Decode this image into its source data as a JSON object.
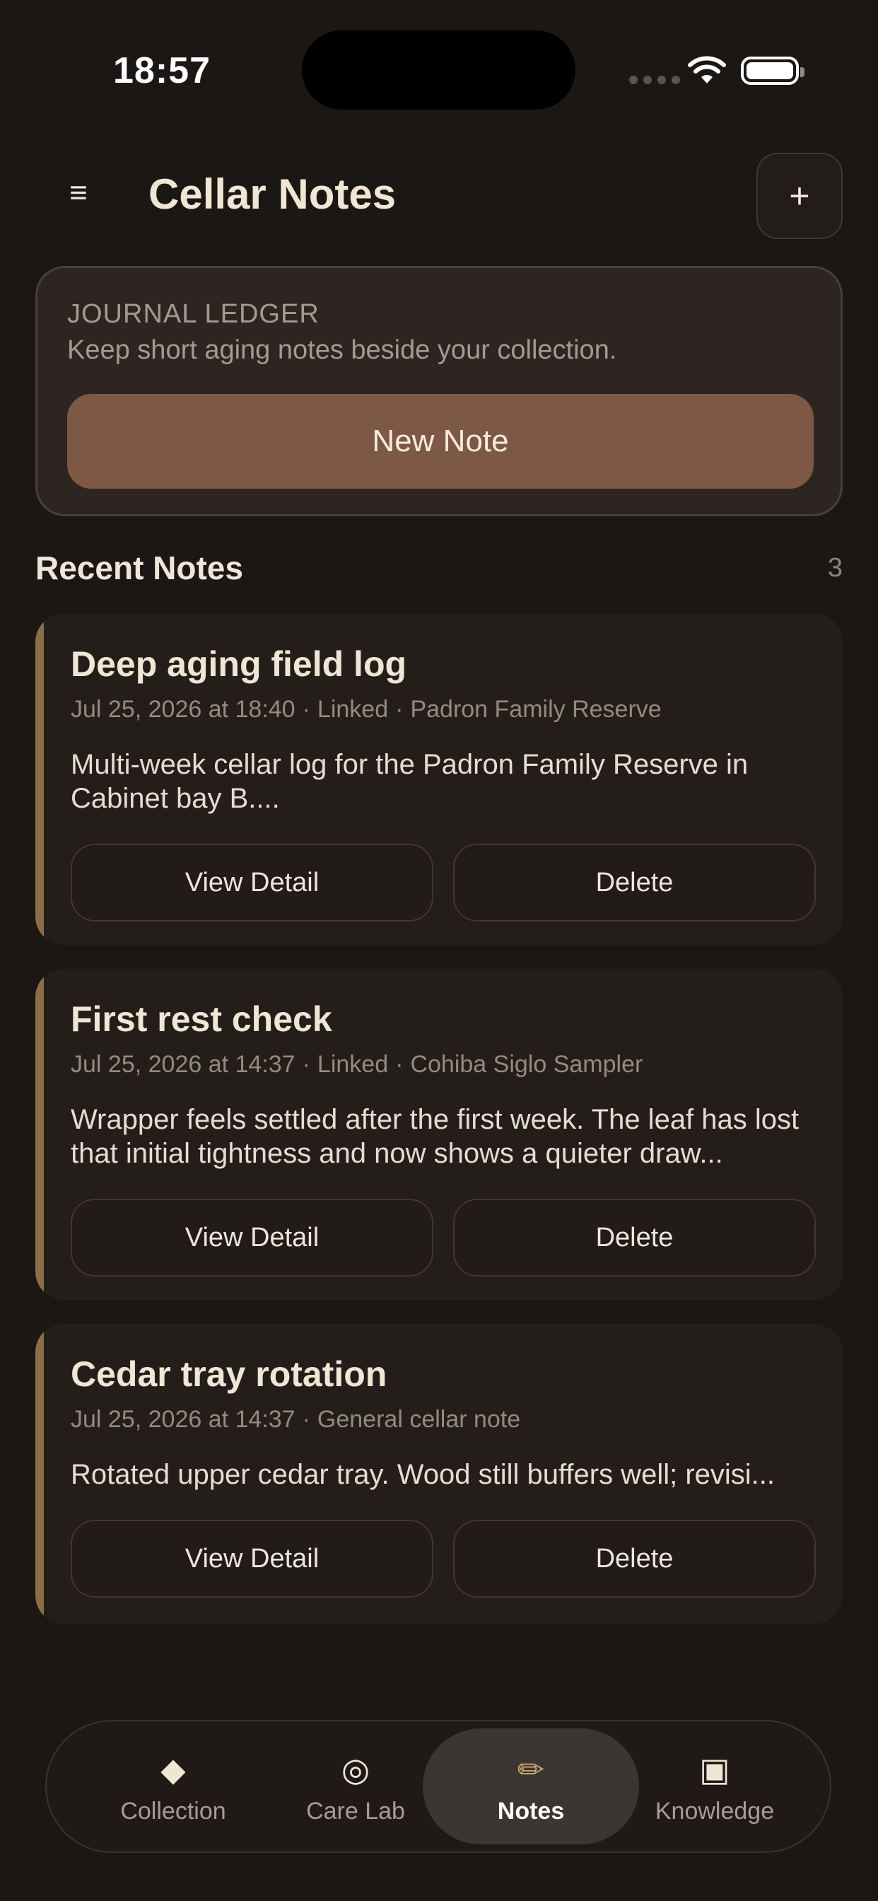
{
  "status_bar": {
    "time": "18:57"
  },
  "header": {
    "title": "Cellar Notes",
    "menu_icon": "≡",
    "add_icon": "+"
  },
  "ledger": {
    "eyebrow": "JOURNAL LEDGER",
    "description": "Keep short aging notes beside your collection.",
    "button_label": "New Note"
  },
  "section": {
    "title": "Recent Notes",
    "count": "3"
  },
  "notes": [
    {
      "title": "Deep aging field log",
      "date": "Jul 25, 2026 at 18:40",
      "status": "Linked",
      "linked_item": "Padron Family Reserve",
      "body": "Multi-week cellar log for the Padron Family Reserve in Cabinet bay B....",
      "view_label": "View Detail",
      "delete_label": "Delete"
    },
    {
      "title": "First rest check",
      "date": "Jul 25, 2026 at 14:37",
      "status": "Linked",
      "linked_item": "Cohiba Siglo Sampler",
      "body": "Wrapper feels settled after the first week. The leaf has lost that initial tightness and now shows a quieter draw...",
      "view_label": "View Detail",
      "delete_label": "Delete"
    },
    {
      "title": "Cedar tray rotation",
      "date": "Jul 25, 2026 at 14:37",
      "status": "General cellar note",
      "body": "Rotated upper cedar tray. Wood still buffers well; revisi...",
      "view_label": "View Detail",
      "delete_label": "Delete"
    }
  ],
  "tabbar": {
    "active": "Notes",
    "tabs": [
      {
        "label": "Collection",
        "icon": "diamond-icon",
        "glyph": "◆"
      },
      {
        "label": "Care Lab",
        "icon": "target-icon",
        "glyph": "◎"
      },
      {
        "label": "Notes",
        "icon": "pencil-icon",
        "glyph": "✏"
      },
      {
        "label": "Knowledge",
        "icon": "square-icon",
        "glyph": "▣"
      }
    ]
  },
  "colors": {
    "background": "#1b1715",
    "accent": "#7d5945",
    "note_stripe": "#8d6d45"
  }
}
